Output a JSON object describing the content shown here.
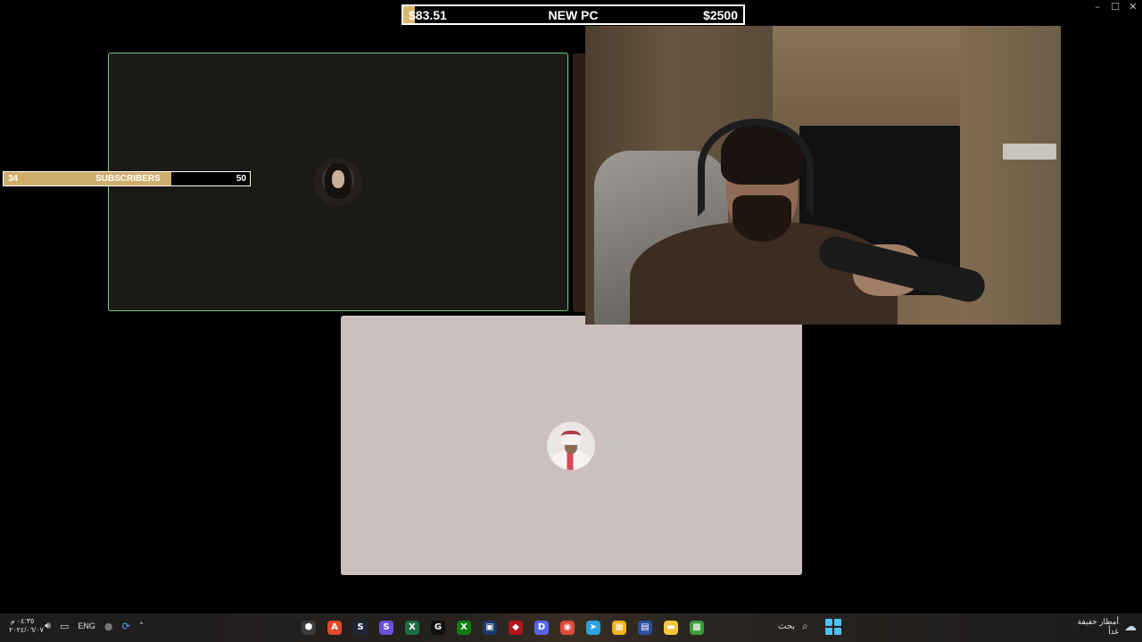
{
  "window": {
    "controls": [
      "–",
      "☐",
      "✕"
    ]
  },
  "donation_goal": {
    "current": "$83.51",
    "title": "NEW PC",
    "target": "$2500",
    "progress": 0.0334,
    "fill_color": "#d7b66d"
  },
  "subscriber_goal": {
    "current": "34",
    "title": "SUBSCRIBERS",
    "target": "50",
    "progress": 0.68,
    "fill_color": "#cfae6b"
  },
  "call": {
    "participants": [
      {
        "name": "participant-1",
        "tile_color": "#1c1a17",
        "speaking_border": "#6fd17f"
      },
      {
        "name": "participant-2",
        "tile_color": "#ccc0bf"
      }
    ]
  },
  "taskbar": {
    "clock_time": "٠٤:٣٥ م",
    "clock_date": "٢٠٢٤/٠٦/٠٧",
    "language": "ENG",
    "tray_icons": [
      "volume-icon",
      "display-icon",
      "mic-icon",
      "sync-icon",
      "chevron-up-icon"
    ],
    "apps": [
      {
        "name": "app-settings-icon",
        "color": "#3b3b3b",
        "glyph": "⬢"
      },
      {
        "name": "app-red-icon",
        "color": "#e04a2a",
        "glyph": "A"
      },
      {
        "name": "steam-icon",
        "color": "#1b2838",
        "glyph": "S"
      },
      {
        "name": "app-purple-icon",
        "color": "#6b4fd8",
        "glyph": "S"
      },
      {
        "name": "excel-icon",
        "color": "#1d6f42",
        "glyph": "X"
      },
      {
        "name": "g-hub-icon",
        "color": "#111111",
        "glyph": "G"
      },
      {
        "name": "xbox-icon",
        "color": "#107c10",
        "glyph": "X"
      },
      {
        "name": "app-blue-icon",
        "color": "#1a3a6b",
        "glyph": "▣"
      },
      {
        "name": "app-red-shape-icon",
        "color": "#b3141d",
        "glyph": "◆"
      },
      {
        "name": "discord-icon",
        "color": "#5865f2",
        "glyph": "D"
      },
      {
        "name": "chrome-icon",
        "color": "#dd4b39",
        "glyph": "◉"
      },
      {
        "name": "telegram-icon",
        "color": "#2aa3df",
        "glyph": "➤"
      },
      {
        "name": "store-icon",
        "color": "#f1b319",
        "glyph": "▦"
      },
      {
        "name": "app-doc-icon",
        "color": "#2b4f9e",
        "glyph": "▤"
      },
      {
        "name": "file-explorer-icon",
        "color": "#f4c63d",
        "glyph": "▬"
      },
      {
        "name": "app-green-icon",
        "color": "#3a9d3a",
        "glyph": "▩"
      }
    ],
    "search_label": "بحث",
    "weather_title": "أمطار خفيفة",
    "weather_sub": "غداً"
  }
}
